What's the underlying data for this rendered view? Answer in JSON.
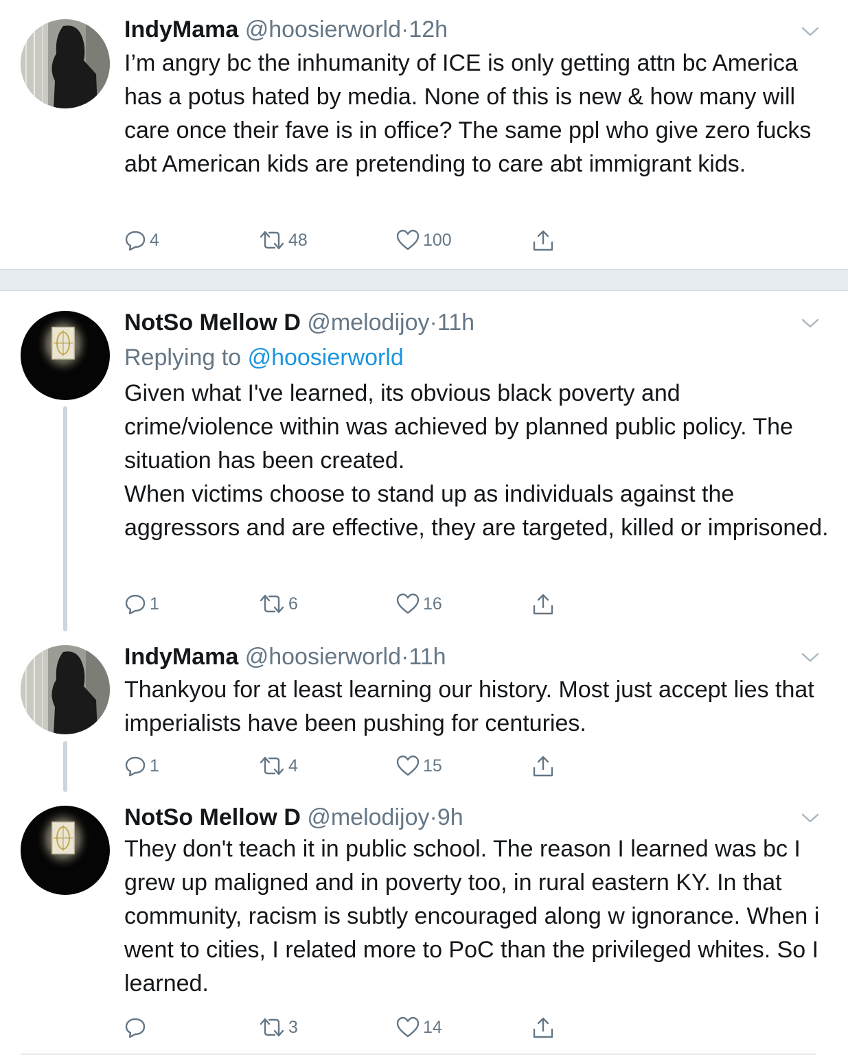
{
  "tweets": [
    {
      "name": "IndyMama",
      "handle": "@hoosierworld",
      "dot": "·",
      "time": "12h",
      "text_lines": [
        "I’m angry bc the inhumanity of ICE is only getting attn bc America has a potus hated by media. None of this is new & how many will care once their fave is in office? The same ppl who give zero fucks abt American kids are pretending to care abt immigrant kids."
      ],
      "replies": "4",
      "retweets": "48",
      "likes": "100"
    },
    {
      "name": "NotSo Mellow D",
      "handle": "@melodijoy",
      "dot": "·",
      "time": "11h",
      "replying_prefix": "Replying to",
      "replying_to": "@hoosierworld",
      "text_lines": [
        "Given what I've learned, its obvious black poverty and crime/violence within was achieved by planned public policy. The situation has been created.",
        "When victims choose to stand up as individuals against the aggressors and are effective, they are targeted, killed or imprisoned."
      ],
      "replies": "1",
      "retweets": "6",
      "likes": "16"
    },
    {
      "name": "IndyMama",
      "handle": "@hoosierworld",
      "dot": "·",
      "time": "11h",
      "text_lines": [
        "Thankyou for at least learning our history. Most just accept lies that imperialists have been pushing for centuries."
      ],
      "replies": "1",
      "retweets": "4",
      "likes": "15"
    },
    {
      "name": "NotSo Mellow D",
      "handle": "@melodijoy",
      "dot": "·",
      "time": "9h",
      "text_lines": [
        "They don't teach it in public school. The reason I learned was bc I grew up maligned and in poverty too, in rural eastern KY. In that community, racism is subtly encouraged along w ignorance. When i went to cities, I related more to PoC than the privileged whites. So I learned."
      ],
      "replies": "",
      "retweets": "3",
      "likes": "14"
    }
  ],
  "icons": {
    "reply": "reply-icon",
    "retweet": "retweet-icon",
    "like": "heart-icon",
    "share": "share-icon",
    "menu": "chevron-down-icon"
  },
  "colors": {
    "text": "#14171a",
    "secondary": "#657786",
    "link": "#1b95e0",
    "separator": "#e6ecf0",
    "thread_line": "#ccd6dd"
  }
}
